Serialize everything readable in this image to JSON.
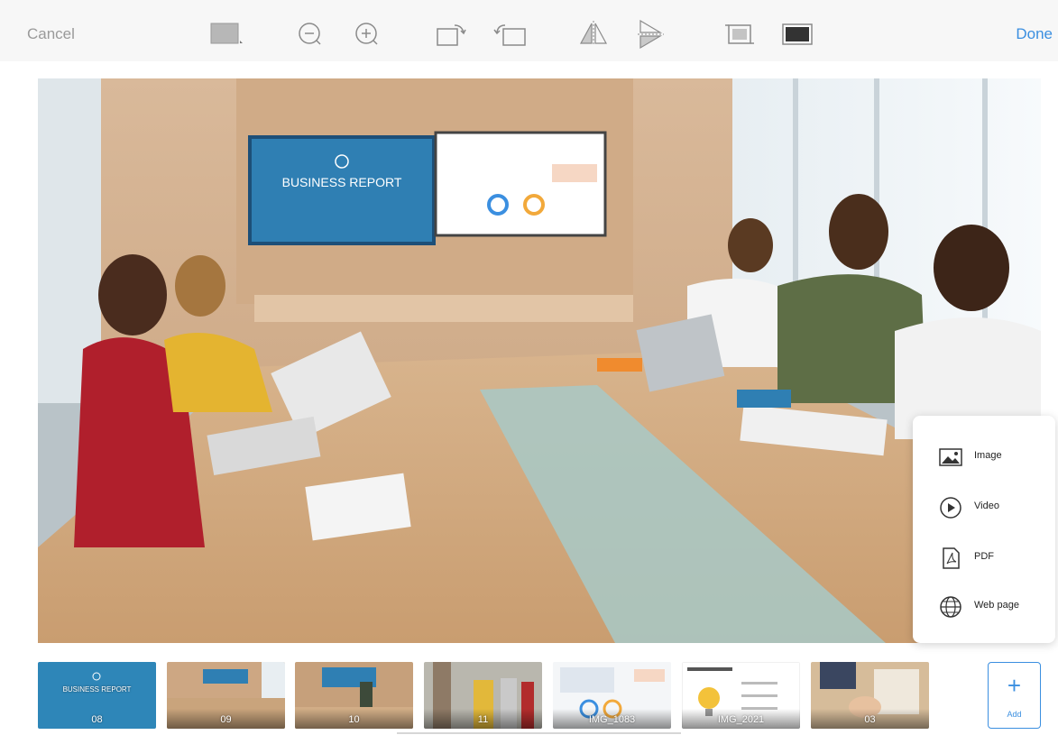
{
  "toolbar": {
    "cancel_label": "Cancel",
    "done_label": "Done",
    "tools": [
      {
        "name": "background-color-icon"
      },
      {
        "name": "zoom-out-icon"
      },
      {
        "name": "zoom-in-icon"
      },
      {
        "name": "rotate-right-icon"
      },
      {
        "name": "rotate-left-icon"
      },
      {
        "name": "flip-horizontal-icon"
      },
      {
        "name": "flip-vertical-icon"
      },
      {
        "name": "crop-icon"
      },
      {
        "name": "fill-icon"
      }
    ]
  },
  "canvas": {
    "screen_title": "BUSINESS REPORT"
  },
  "add_menu": {
    "items": [
      {
        "label": "Image",
        "icon": "image-icon"
      },
      {
        "label": "Video",
        "icon": "video-play-icon"
      },
      {
        "label": "PDF",
        "icon": "pdf-icon"
      },
      {
        "label": "Web page",
        "icon": "globe-icon"
      }
    ]
  },
  "filmstrip": {
    "thumbnails": [
      {
        "label": "08",
        "title": "BUSINESS REPORT"
      },
      {
        "label": "09"
      },
      {
        "label": "10"
      },
      {
        "label": "11"
      },
      {
        "label": "IMG_1083"
      },
      {
        "label": "IMG_2021"
      },
      {
        "label": "03"
      }
    ],
    "add_label": "Add"
  },
  "colors": {
    "accent": "#3b8fe0",
    "toolbar_bg": "#f7f7f7"
  }
}
